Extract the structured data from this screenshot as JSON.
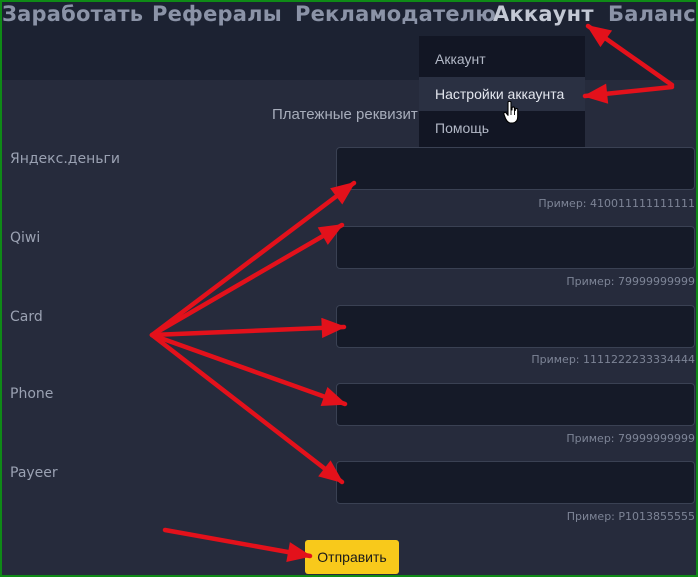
{
  "nav": {
    "items": [
      "Заработать",
      "Рефералы",
      "Рекламодателю",
      "Аккаунт",
      "Баланс"
    ]
  },
  "dropdown": {
    "items": [
      "Аккаунт",
      "Настройки аккаунта",
      "Помощь"
    ]
  },
  "form": {
    "title": "Платежные реквизит",
    "fields": [
      {
        "label": "Яндекс.деньги",
        "value": "",
        "hint": "Пример: 410011111111111"
      },
      {
        "label": "Qiwi",
        "value": "",
        "hint": "Пример: 79999999999"
      },
      {
        "label": "Card",
        "value": "",
        "hint": "Пример: 1111222233334444"
      },
      {
        "label": "Phone",
        "value": "",
        "hint": "Пример: 79999999999"
      },
      {
        "label": "Payeer",
        "value": "",
        "hint": "Пример: P1013855555"
      }
    ],
    "submit_label": "Отправить"
  },
  "colors": {
    "page_bg": "#262b3c",
    "navbar_bg": "#1c2232",
    "dropdown_bg": "#121624",
    "input_bg": "#151a28",
    "button_bg": "#f8c91b",
    "arrow": "#e3111b",
    "frame": "#0f8a17"
  },
  "icons": [
    "hand-cursor-icon"
  ]
}
